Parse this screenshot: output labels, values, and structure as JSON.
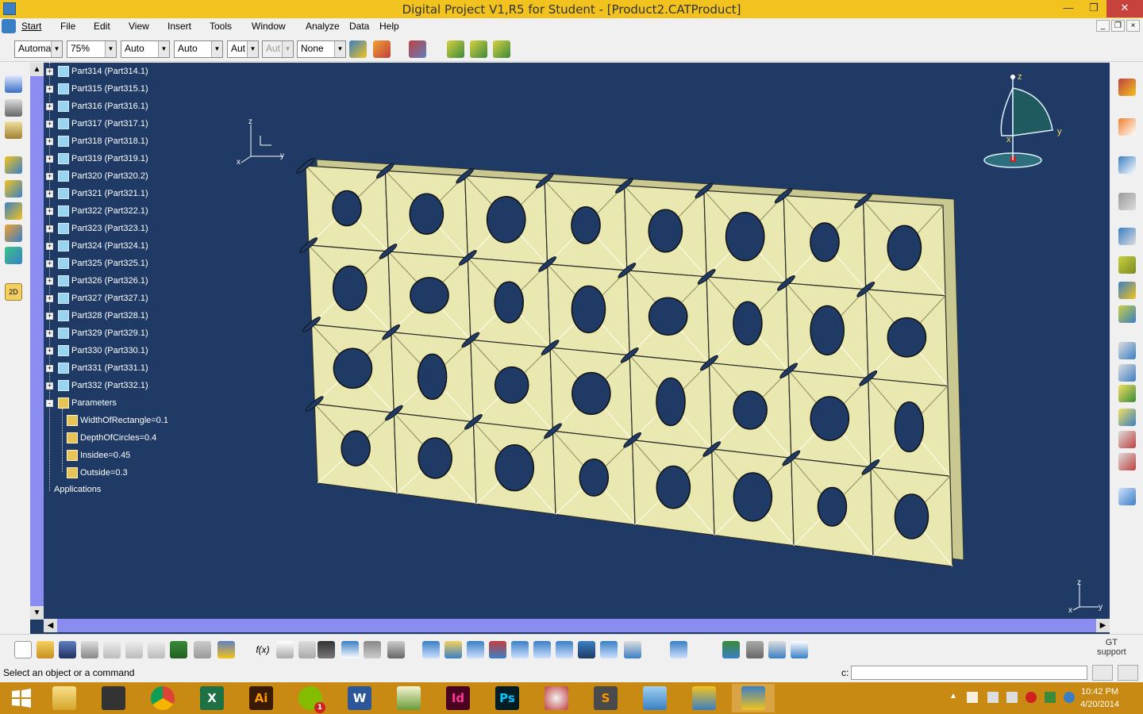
{
  "window": {
    "title": "Digital Project V1,R5 for Student - [Product2.CATProduct]",
    "controls": [
      "minimize",
      "restore",
      "close"
    ]
  },
  "menu": [
    "Start",
    "File",
    "Edit",
    "View",
    "Insert",
    "Tools",
    "Window",
    "Analyze",
    "Data",
    "Help"
  ],
  "toolbar": {
    "combos": [
      "Automa",
      "75%",
      "Auto",
      "Auto",
      "Aut",
      "Aut",
      "None"
    ]
  },
  "tree": {
    "parts": [
      "Part314 (Part314.1)",
      "Part315 (Part315.1)",
      "Part316 (Part316.1)",
      "Part317 (Part317.1)",
      "Part318 (Part318.1)",
      "Part319 (Part319.1)",
      "Part320 (Part320.2)",
      "Part321 (Part321.1)",
      "Part322 (Part322.1)",
      "Part323 (Part323.1)",
      "Part324 (Part324.1)",
      "Part325 (Part325.1)",
      "Part326 (Part326.1)",
      "Part327 (Part327.1)",
      "Part328 (Part328.1)",
      "Part329 (Part329.1)",
      "Part330 (Part330.1)",
      "Part331 (Part331.1)",
      "Part332 (Part332.1)"
    ],
    "parameters_label": "Parameters",
    "parameters": [
      "WidthOfRectangle=0.1",
      "DepthOfCircles=0.4",
      "Insidee=0.45",
      "Outside=0.3"
    ],
    "applications_label": "Applications"
  },
  "axes": {
    "x": "x",
    "y": "y",
    "z": "z"
  },
  "gt_support": {
    "line1": "GT",
    "line2": "support"
  },
  "status": {
    "message": "Select an object or a command",
    "command_label": "c:",
    "command_value": ""
  },
  "taskbar": {
    "apps": [
      "start",
      "file-explorer",
      "inkscape",
      "chrome",
      "excel",
      "illustrator",
      "spotify",
      "word",
      "chart-app",
      "indesign",
      "photoshop",
      "paint-app",
      "sublime",
      "photo-viewer",
      "catia-1",
      "digital-project"
    ],
    "labels": {
      "illustrator": "Ai",
      "indesign": "Id",
      "photoshop": "Ps",
      "sublime": "S",
      "word": "W",
      "excel": "X",
      "spotify_badge": "1"
    },
    "time": "10:42 PM",
    "date": "4/20/2014"
  },
  "colors": {
    "titlebar": "#f2c31e",
    "viewport": "#1f3a64",
    "model_face": "#e8e8b0",
    "taskbar": "#c88a12"
  }
}
